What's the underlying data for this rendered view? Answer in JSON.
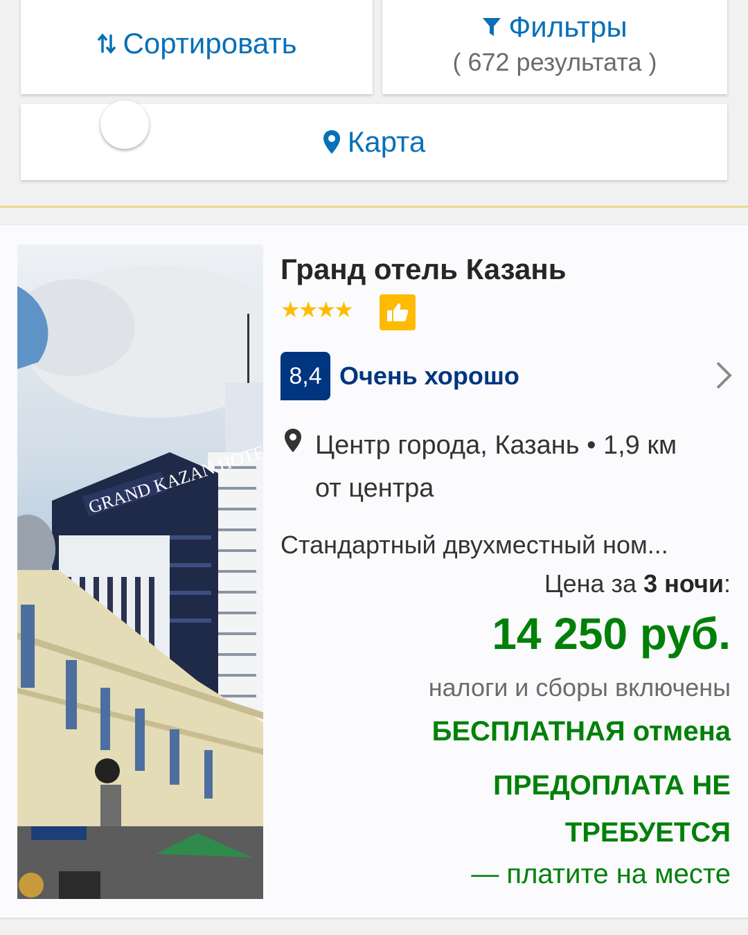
{
  "toolbar": {
    "sort_label": "Сортировать",
    "filter_label": "Фильтры",
    "results_count": "( 672 результата )",
    "map_label": "Карта"
  },
  "hotel": {
    "name": "Гранд отель Казань",
    "stars": "★★★★",
    "stars_count": 4,
    "score": "8,4",
    "score_text": "Очень хорошо",
    "location": "Центр города, Казань • 1,9 км от центра",
    "room": "Стандартный двухместный ном...",
    "price_prefix": "Цена за ",
    "price_nights": "3 ночи",
    "price_suffix": ":",
    "price": "14 250 руб.",
    "taxes": "налоги и сборы включены",
    "free_cancellation": "БЕСПЛАТНАЯ отмена",
    "no_prepayment": "ПРЕДОПЛАТА НЕ ТРЕБУЕТСЯ",
    "pay_onsite": "— платите на месте",
    "photo_sign_text": "GRAND KAZAN HOTEL"
  },
  "colors": {
    "link_blue": "#0770b8",
    "score_navy": "#003580",
    "price_green": "#008009",
    "star_yellow": "#febb02"
  },
  "icons": [
    "sort-arrows-icon",
    "filter-funnel-icon",
    "map-pin-icon",
    "thumbs-up-icon",
    "chevron-right-icon",
    "location-pin-icon"
  ]
}
